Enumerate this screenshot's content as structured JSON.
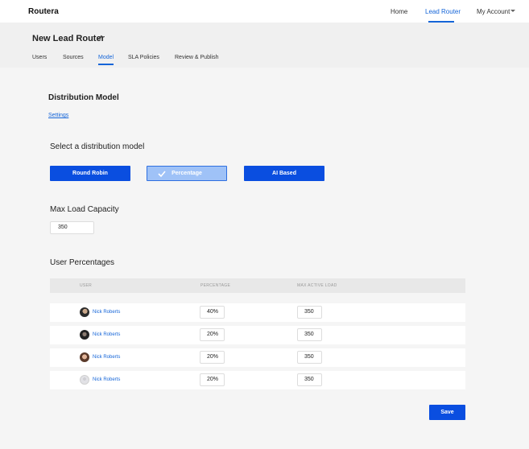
{
  "nav": {
    "brand": "Routera",
    "links": [
      "Home",
      "Lead Router",
      "My Account"
    ]
  },
  "header": {
    "title": "New Lead Router",
    "tabs": [
      "Users",
      "Sources",
      "Model",
      "SLA Policies",
      "Review & Publish"
    ],
    "active_tab": "Model"
  },
  "section": {
    "title": "Distribution Model",
    "settings_link": "Settings"
  },
  "distribution": {
    "label": "Select a distribution model",
    "options": [
      "Round Robin",
      "Percentage",
      "AI Based"
    ],
    "selected": "Percentage"
  },
  "load": {
    "label": "Max Load Capacity",
    "value": "350"
  },
  "users": {
    "label": "User Percentages",
    "columns": [
      "USER",
      "PERCENTAGE",
      "MAX ACTIVE LOAD"
    ],
    "rows": [
      {
        "name": "Nick Roberts",
        "percentage": "40%",
        "max_load": "350"
      },
      {
        "name": "Nick Roberts",
        "percentage": "20%",
        "max_load": "350"
      },
      {
        "name": "Nick Roberts",
        "percentage": "20%",
        "max_load": "350"
      },
      {
        "name": "Nick Roberts",
        "percentage": "20%",
        "max_load": "350"
      }
    ]
  },
  "actions": {
    "save_label": "Save"
  },
  "colors": {
    "accent": "#0a4ee0",
    "link": "#1565d8",
    "selected_option_bg": "#9fc2f7"
  }
}
